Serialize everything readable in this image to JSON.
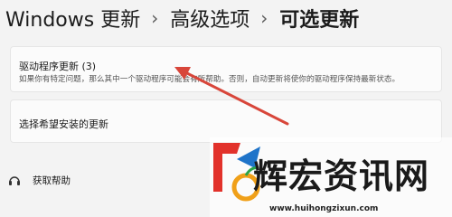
{
  "breadcrumb": {
    "items": [
      "Windows 更新",
      "高级选项",
      "可选更新"
    ]
  },
  "drivers_card": {
    "title": "驱动程序更新 (3)",
    "description": "如果你有特定问题，那么其中一个驱动程序可能会有所帮助。否则，自动更新将使你的驱动程序保持最新状态。"
  },
  "select_card": {
    "title": "选择希望安装的更新"
  },
  "help": {
    "label": "获取帮助",
    "icon": "help-icon"
  },
  "watermark": {
    "text": "辉宏资讯网",
    "url": "www.huihongzixun.com"
  },
  "colors": {
    "annotation_arrow": "#d8463a",
    "background": "#f3f3f3",
    "card": "#fbfbfb"
  }
}
